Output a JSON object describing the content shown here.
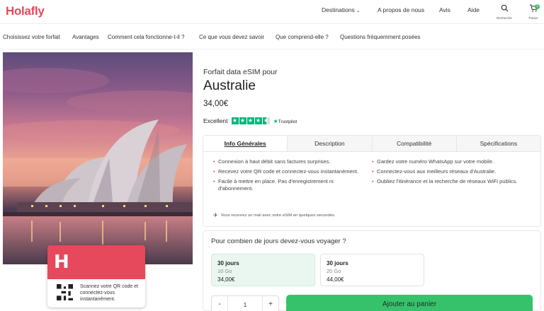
{
  "header": {
    "logo": "Holafly",
    "nav": [
      {
        "label": "Destinations",
        "has_dropdown": true
      },
      {
        "label": "A propos de nous"
      },
      {
        "label": "Avis"
      },
      {
        "label": "Aide"
      }
    ],
    "search_label": "Recherche",
    "cart_label": "Panier",
    "cart_count": "1"
  },
  "subnav": [
    "Choisissez votre forfait",
    "Avantages",
    "Comment cela fonctionne-t-il ?",
    "Ce que vous devez savoir",
    "Que comprend-elle ?",
    "Questions fréquemment posées"
  ],
  "product": {
    "pre_title": "Forfait data eSIM pour",
    "title": "Australie",
    "price": "34,00€",
    "rating_label": "Excellent",
    "rating_stars": 4.5,
    "trustpilot": "Trustpilot"
  },
  "tabs": [
    {
      "label": "Info Générales",
      "active": true
    },
    {
      "label": "Description",
      "active": false
    },
    {
      "label": "Compatibilité",
      "active": false
    },
    {
      "label": "Spécifications",
      "active": false
    }
  ],
  "info_left": [
    "Connexion à haut débit sans factures surprises.",
    "Recevez votre QR code et connectez-vous instantanément.",
    "Facile à mettre en place. Pas d'enregistrement ni d'abonnement."
  ],
  "info_right": [
    "Gardez votre numéro WhatsApp sur votre mobile.",
    "Connectez-vous aux meilleurs réseaux d'Australie.",
    "Oubliez l'itinérance et la recherche de réseaux WiFi publics."
  ],
  "note": "Vous recevrez un mail avec votre eSIM en quelques secondes.",
  "days": {
    "question": "Pour combien de jours devez-vous voyager ?",
    "options": [
      {
        "days": "30 jours",
        "data": "10 Go",
        "price": "34,00€",
        "selected": true
      },
      {
        "days": "30 jours",
        "data": "20 Go",
        "price": "44,00€",
        "selected": false
      }
    ]
  },
  "quantity": {
    "minus": "-",
    "value": "1",
    "plus": "+"
  },
  "add_to_cart": "Ajouter au panier",
  "qr_card": {
    "logo": "H",
    "text": "Scannez votre QR code et connectez-vous instantanément."
  },
  "colors": {
    "brand": "#e6485c",
    "accent": "#36c26b",
    "trustpilot": "#00b67a"
  }
}
